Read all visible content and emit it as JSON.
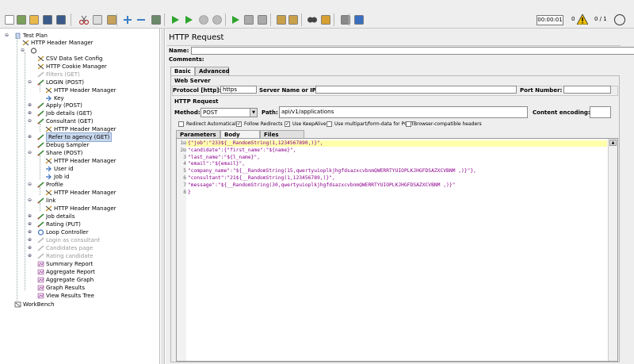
{
  "toolbar": {
    "icons": [
      "new-icon",
      "templates-icon",
      "open-icon",
      "save-icon",
      "save-as-icon",
      "cut-icon",
      "copy-icon",
      "paste-icon",
      "expand-icon",
      "collapse-icon",
      "toggle-icon",
      "start-icon",
      "start-no-pause-icon",
      "stop-icon",
      "shutdown-icon",
      "remote-start-icon",
      "remote-stop-icon",
      "remote-shutdown-icon",
      "clear-icon",
      "clear-all-icon",
      "search-icon",
      "reset-search-icon",
      "function-helper-icon",
      "help-icon"
    ],
    "timer": "00:00:01",
    "warnings": "0",
    "threads": "0 / 1"
  },
  "tree": {
    "nodes": [
      {
        "label": "Test Plan"
      },
      {
        "label": "HTTP Header Manager"
      },
      {
        "label": ""
      },
      {
        "label": "CSV Data Set Config"
      },
      {
        "label": "HTTP Cookie Manager"
      },
      {
        "label": "Filters (GET)"
      },
      {
        "label": "LOGIN (POST)"
      },
      {
        "label": "HTTP Header Manager"
      },
      {
        "label": "Key"
      },
      {
        "label": "Apply (POST)"
      },
      {
        "label": "Job details (GET)"
      },
      {
        "label": "Consultant (GET)"
      },
      {
        "label": "HTTP Header Manager"
      },
      {
        "label": "Refer to agency (GET)"
      },
      {
        "label": "Debug Sampler"
      },
      {
        "label": "Share (POST)"
      },
      {
        "label": "HTTP Header Manager"
      },
      {
        "label": "User id"
      },
      {
        "label": "Job id"
      },
      {
        "label": "Profile"
      },
      {
        "label": "HTTP Header Manager"
      },
      {
        "label": "link"
      },
      {
        "label": "HTTP Header Manager"
      },
      {
        "label": "Job details"
      },
      {
        "label": "Rating (PUT)"
      },
      {
        "label": "Loop Controller"
      },
      {
        "label": "Login as consultant"
      },
      {
        "label": "Candidates page"
      },
      {
        "label": "Rating candidate"
      },
      {
        "label": "Summary Report"
      },
      {
        "label": "Aggregate Report"
      },
      {
        "label": "Aggregate Graph"
      },
      {
        "label": "Graph Results"
      },
      {
        "label": "View Results Tree"
      },
      {
        "label": "WorkBench"
      }
    ]
  },
  "panel": {
    "title": "HTTP Request",
    "name_label": "Name:",
    "name_value": "",
    "comments_label": "Comments:",
    "tabs": [
      "Basic",
      "Advanced"
    ],
    "web_server_title": "Web Server",
    "protocol_label": "Protocol [http]:",
    "protocol_value": "https",
    "server_label": "Server Name or IP:",
    "server_value": "",
    "port_label": "Port Number:",
    "port_value": "",
    "http_request_title": "HTTP Request",
    "method_label": "Method:",
    "method_value": "POST",
    "path_label": "Path:",
    "path_value": "api/v1/applications",
    "encoding_label": "Content encoding:",
    "encoding_value": "",
    "checkboxes": [
      {
        "label": "Redirect Automatically",
        "checked": false
      },
      {
        "label": "Follow Redirects",
        "checked": true
      },
      {
        "label": "Use KeepAlive",
        "checked": true
      },
      {
        "label": "Use multipart/form-data for POST",
        "checked": false
      },
      {
        "label": "Browser-compatible headers",
        "checked": false
      }
    ],
    "body_tabs": [
      "Parameters",
      "Body Data",
      "Files Upload"
    ],
    "body_lines": [
      {
        "n": "1⊟",
        "code": "{\"job\":\"233${__RandomString(1,1234567890,)}\","
      },
      {
        "n": "2⊟",
        "code": "\"candidate\":{\"first_name\":\"${name}\","
      },
      {
        "n": "3",
        "code": "\"last_name\":\"${l_name}\","
      },
      {
        "n": "4",
        "code": "\"email\":\"${email}\","
      },
      {
        "n": "5",
        "code": "\"company_name\":\"${__RandomString(15,qwertyuioplkjhgfdsazxcvbnmQWERRTYUIOPLKJHGFDSAZXCVBNM ,)}\"},"
      },
      {
        "n": "6",
        "code": "\"consultant\":\"21${__RandomString(1,123456789,)}\","
      },
      {
        "n": "7",
        "code": "\"message\":\"${__RandomString(30,qwertyuioplkjhgfdsazxcvbnmQWERRTYUIOPLKJHGFDSAZXCVBNM ,)}\""
      },
      {
        "n": "8",
        "code": "}"
      }
    ]
  }
}
